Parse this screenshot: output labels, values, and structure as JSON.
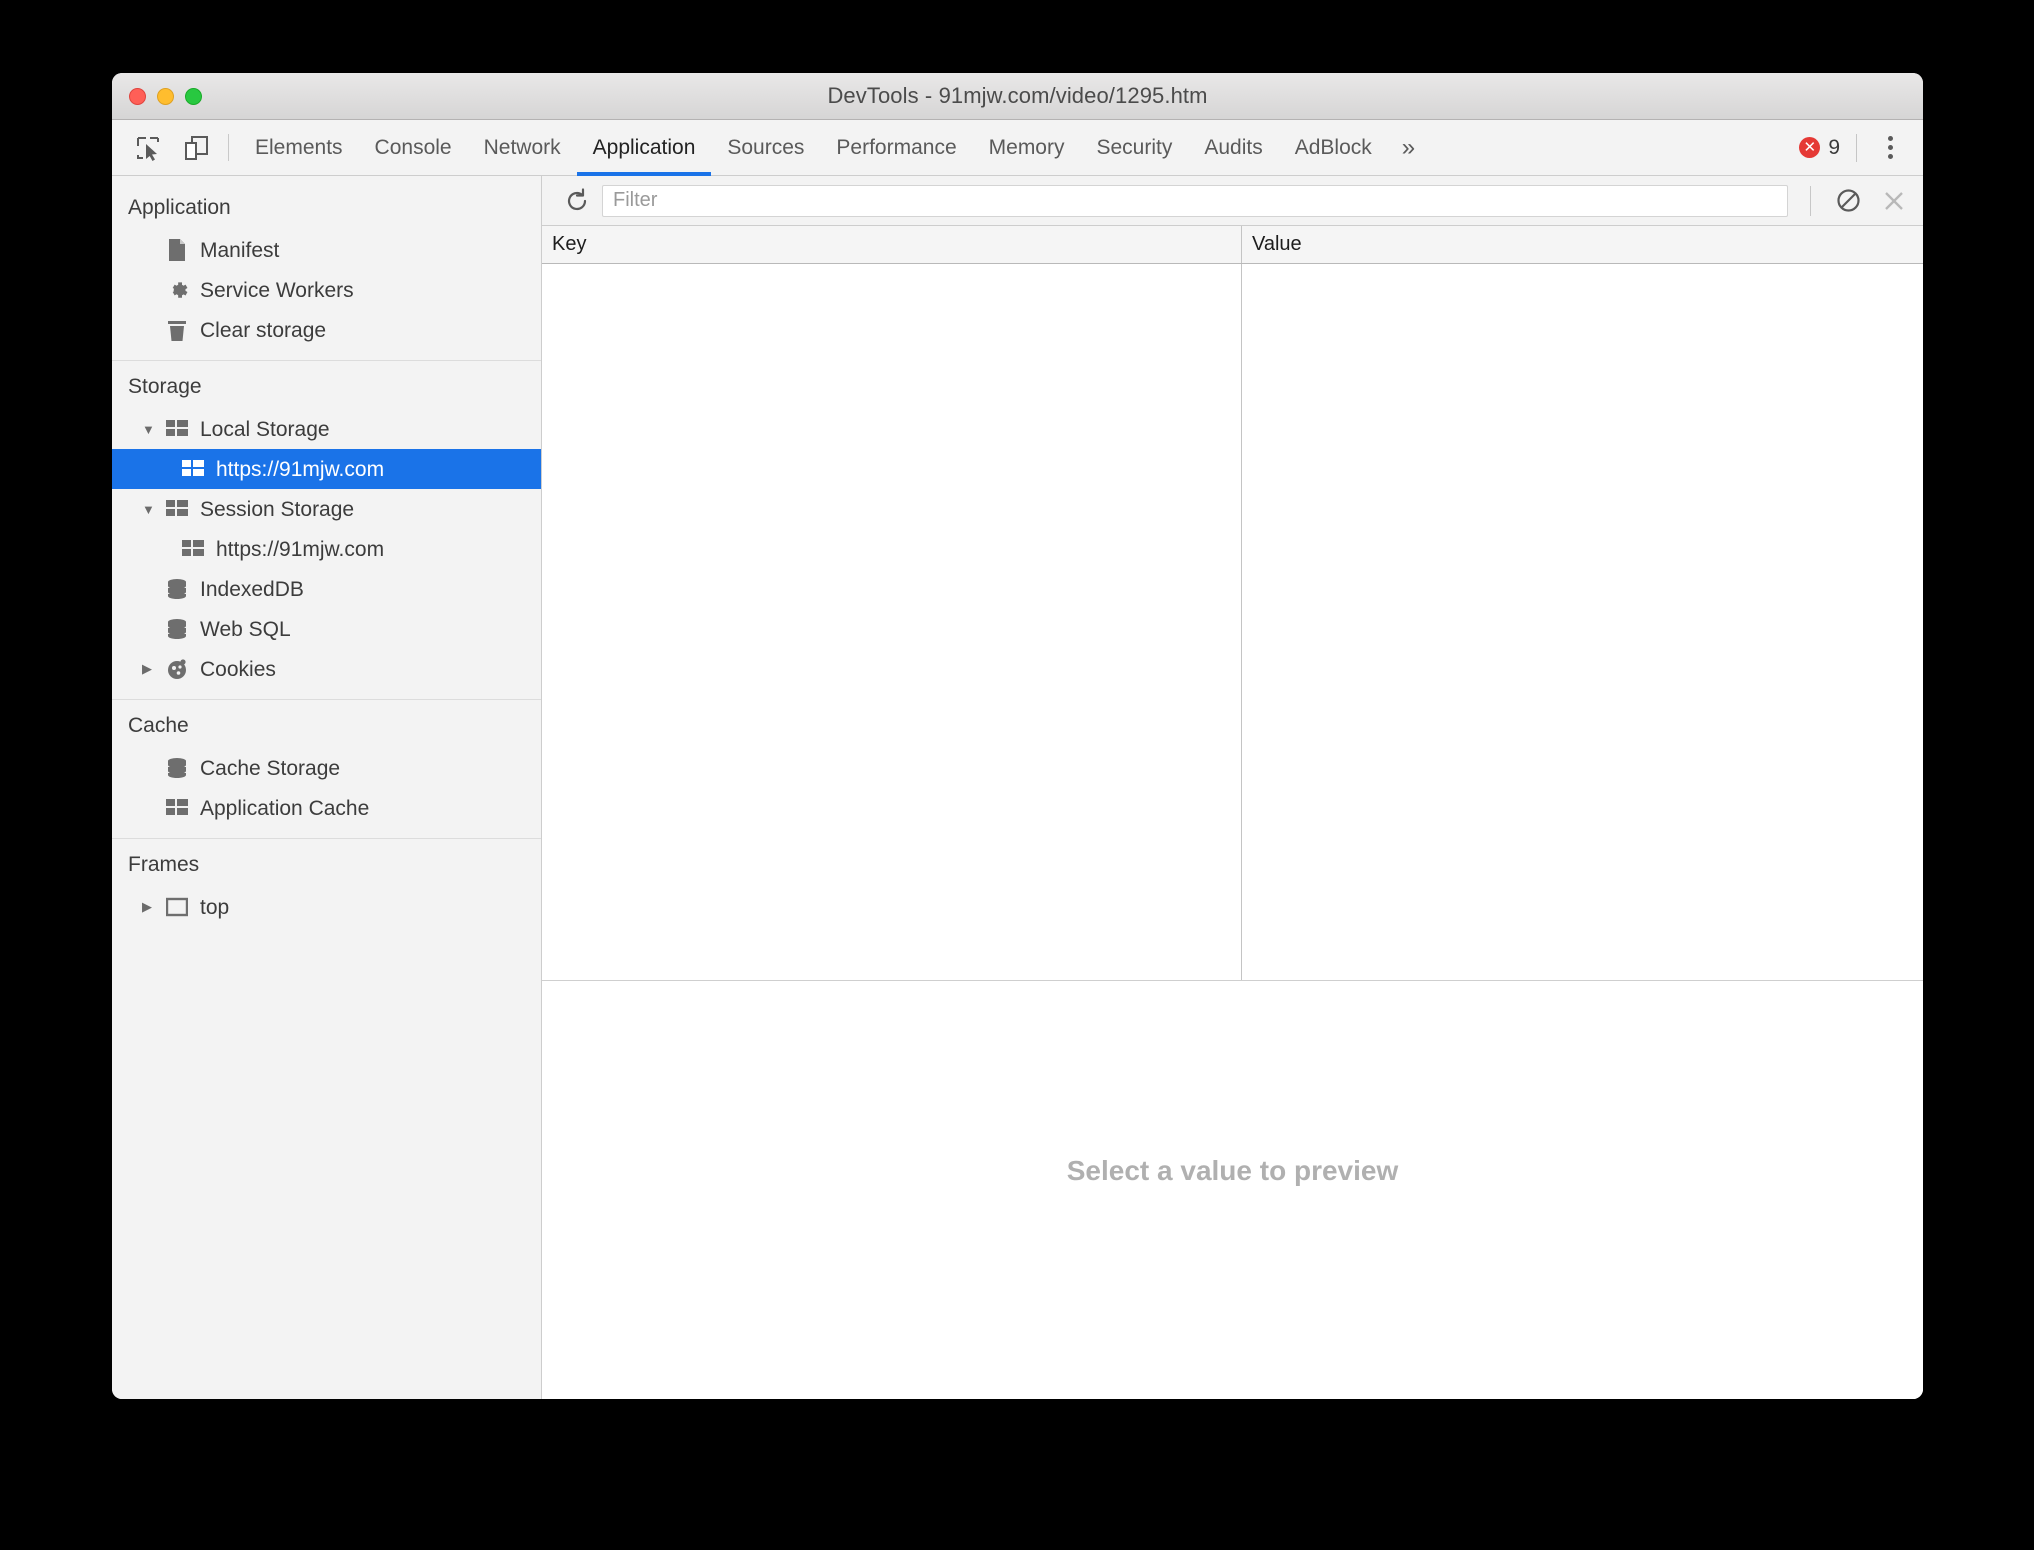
{
  "window": {
    "title": "DevTools - 91mjw.com/video/1295.htm",
    "traffic_lights": [
      {
        "name": "close",
        "color": "#ff5f57"
      },
      {
        "name": "minimize",
        "color": "#ffbd2e"
      },
      {
        "name": "zoom",
        "color": "#28c840"
      }
    ]
  },
  "tabbar": {
    "inspect_icon": "inspect-element-icon",
    "device_icon": "device-toolbar-icon",
    "tabs": [
      {
        "label": "Elements",
        "active": false
      },
      {
        "label": "Console",
        "active": false
      },
      {
        "label": "Network",
        "active": false
      },
      {
        "label": "Application",
        "active": true
      },
      {
        "label": "Sources",
        "active": false
      },
      {
        "label": "Performance",
        "active": false
      },
      {
        "label": "Memory",
        "active": false
      },
      {
        "label": "Security",
        "active": false
      },
      {
        "label": "Audits",
        "active": false
      },
      {
        "label": "AdBlock",
        "active": false
      }
    ],
    "more_tabs": "»",
    "error_count": "9",
    "error_icon": "error-circle-icon",
    "menu_icon": "kebab-menu-icon",
    "accent_color": "#1a73e8",
    "error_color": "#e53935"
  },
  "sidebar": {
    "sections": [
      {
        "title": "Application",
        "items": [
          {
            "label": "Manifest",
            "icon": "document-icon",
            "indent": 1,
            "arrow": "",
            "selected": false
          },
          {
            "label": "Service Workers",
            "icon": "gear-icon",
            "indent": 1,
            "arrow": "",
            "selected": false
          },
          {
            "label": "Clear storage",
            "icon": "trash-icon",
            "indent": 1,
            "arrow": "",
            "selected": false
          }
        ]
      },
      {
        "title": "Storage",
        "items": [
          {
            "label": "Local Storage",
            "icon": "table-grid-icon",
            "indent": 1,
            "arrow": "down",
            "selected": false
          },
          {
            "label": "https://91mjw.com",
            "icon": "table-grid-icon",
            "indent": 2,
            "arrow": "",
            "selected": true
          },
          {
            "label": "Session Storage",
            "icon": "table-grid-icon",
            "indent": 1,
            "arrow": "down",
            "selected": false
          },
          {
            "label": "https://91mjw.com",
            "icon": "table-grid-icon",
            "indent": 2,
            "arrow": "",
            "selected": false
          },
          {
            "label": "IndexedDB",
            "icon": "database-icon",
            "indent": 1,
            "arrow": "",
            "selected": false
          },
          {
            "label": "Web SQL",
            "icon": "database-icon",
            "indent": 1,
            "arrow": "",
            "selected": false
          },
          {
            "label": "Cookies",
            "icon": "cookie-icon",
            "indent": 1,
            "arrow": "right",
            "selected": false
          }
        ]
      },
      {
        "title": "Cache",
        "items": [
          {
            "label": "Cache Storage",
            "icon": "database-icon",
            "indent": 1,
            "arrow": "",
            "selected": false
          },
          {
            "label": "Application Cache",
            "icon": "table-grid-icon",
            "indent": 1,
            "arrow": "",
            "selected": false
          }
        ]
      },
      {
        "title": "Frames",
        "items": [
          {
            "label": "top",
            "icon": "frame-icon",
            "indent": 1,
            "arrow": "right",
            "selected": false
          }
        ]
      }
    ],
    "selected_color": "#1a73e8"
  },
  "storage_toolbar": {
    "refresh_icon": "refresh-icon",
    "filter_value": "",
    "filter_placeholder": "Filter",
    "clear_all_icon": "clear-all-circle-slash-icon",
    "delete_icon": "delete-x-icon"
  },
  "table": {
    "columns": [
      "Key",
      "Value"
    ],
    "rows": []
  },
  "preview": {
    "empty_message": "Select a value to preview"
  }
}
